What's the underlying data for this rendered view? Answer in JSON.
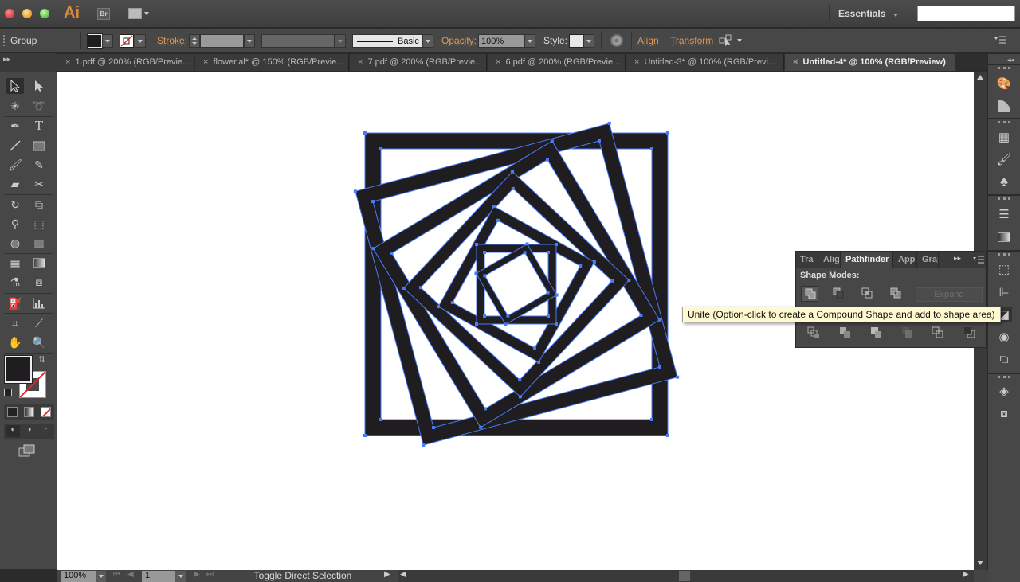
{
  "app": {
    "logo": "Ai",
    "bridge": "Br",
    "workspace": "Essentials",
    "search_value": ""
  },
  "control_bar": {
    "selection_type": "Group",
    "fill_color": "#1f1d1f",
    "stroke_label": "Stroke:",
    "stroke_weight": "",
    "brush_label": "Basic",
    "opacity_label": "Opacity:",
    "opacity_value": "100%",
    "style_label": "Style:",
    "align_label": "Align",
    "transform_label": "Transform"
  },
  "tabs": [
    {
      "label": "1.pdf @ 200% (RGB/Previe...",
      "active": false
    },
    {
      "label": "flower.al* @ 150% (RGB/Previe...",
      "active": false
    },
    {
      "label": "7.pdf @ 200% (RGB/Previe...",
      "active": false
    },
    {
      "label": "6.pdf @ 200% (RGB/Previe...",
      "active": false
    },
    {
      "label": "Untitled-3* @ 100% (RGB/Previ...",
      "active": false
    },
    {
      "label": "Untitled-4* @ 100% (RGB/Preview)",
      "active": true
    }
  ],
  "tools": [
    "selection",
    "direct-selection",
    "magic-wand",
    "lasso",
    "pen",
    "type",
    "line-segment",
    "rectangle",
    "paintbrush",
    "pencil",
    "blob-brush",
    "scissors",
    "rotate",
    "scale",
    "puppet-warp",
    "free-transform",
    "shape-builder",
    "perspective-grid",
    "mesh",
    "gradient",
    "eyedropper",
    "blend",
    "symbol-sprayer",
    "column-graph",
    "artboard",
    "slice",
    "hand",
    "zoom"
  ],
  "pathfinder": {
    "tabs": [
      "Tra",
      "Alig",
      "Pathfinder",
      "App",
      "Grap"
    ],
    "active_tab": "Pathfinder",
    "shape_modes_label": "Shape Modes:",
    "expand_label": "Expand",
    "shape_modes": [
      "unite",
      "minus-front",
      "intersect",
      "exclude"
    ],
    "pathfinders": [
      "divide",
      "trim",
      "merge",
      "crop",
      "outline",
      "minus-back"
    ]
  },
  "tooltip": "Unite (Option-click to create a Compound Shape and add to shape area)",
  "status": {
    "zoom": "100%",
    "artboard": "1",
    "message": "Toggle Direct Selection"
  },
  "colors": {
    "accent": "#e49a52",
    "selection": "#4a7cf7",
    "artwork": "#1f1d1f"
  }
}
